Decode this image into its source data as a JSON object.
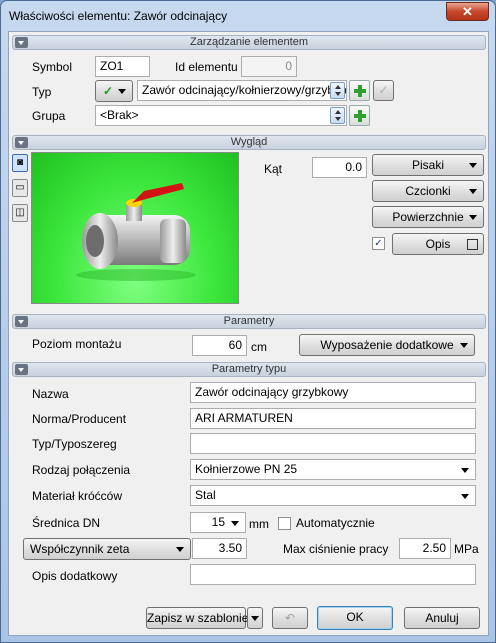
{
  "window": {
    "title": "Właściwości elementu: Zawór odcinający",
    "close_glyph": "✕"
  },
  "sections": {
    "zarzadzanie": "Zarządzanie elementem",
    "wyglad": "Wygląd",
    "parametry": "Parametry",
    "parametry_typu": "Parametry typu"
  },
  "management": {
    "symbol_label": "Symbol",
    "symbol_value": "ZO1",
    "id_label": "Id elementu",
    "id_value": "0",
    "typ_label": "Typ",
    "typ_value": "Zawór odcinający/kołnierzowy/grzybkowy",
    "grupa_label": "Grupa",
    "grupa_value": "<Brak>"
  },
  "appearance": {
    "kat_label": "Kąt",
    "kat_value": "0.0",
    "kat_unit": "°",
    "pisaki": "Pisaki",
    "czcionki": "Czcionki",
    "powierzchnie": "Powierzchnie",
    "opis": "Opis",
    "opis_checked": true,
    "side_tabs": [
      "camera-icon",
      "folder-icon",
      "cube-icon"
    ]
  },
  "parameters": {
    "poziom_label": "Poziom montażu",
    "poziom_value": "60",
    "poziom_unit": "cm",
    "wyposazenie": "Wyposażenie dodatkowe"
  },
  "type_params": {
    "nazwa_label": "Nazwa",
    "nazwa_value": "Zawór odcinający grzybkowy",
    "norma_label": "Norma/Producent",
    "norma_value": "ARI ARMATUREN",
    "typoszereg_label": "Typ/Typoszereg",
    "typoszereg_value": "",
    "rodzaj_label": "Rodzaj połączenia",
    "rodzaj_value": "Kołnierzowe PN 25",
    "material_label": "Materiał króćców",
    "material_value": "Stal",
    "srednica_label": "Średnica DN",
    "srednica_value": "15",
    "srednica_unit": "mm",
    "automatycznie": "Automatycznie",
    "wspolczynnik_label": "Współczynnik zeta",
    "wspolczynnik_value": "3.50",
    "max_label": "Max ciśnienie pracy",
    "max_value": "2.50",
    "max_unit": "MPa",
    "opis_dod_label": "Opis dodatkowy",
    "opis_dod_value": ""
  },
  "footer": {
    "zapisz": "Zapisz w szablonie",
    "ok": "OK",
    "anuluj": "Anuluj",
    "undo_glyph": "↶"
  }
}
